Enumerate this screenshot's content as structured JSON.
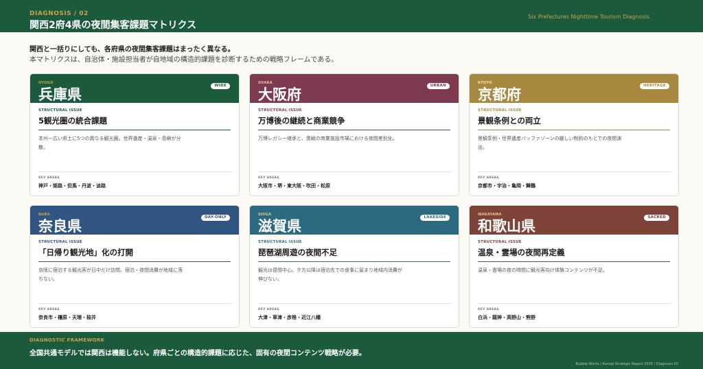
{
  "header": {
    "kicker": "DIAGNOSIS / 02",
    "title": "関西2府4県の夜間集客課題マトリクス",
    "right_label": "Six Prefectures Nighttime Tourism Diagnosis"
  },
  "intro": {
    "line1": "関西と一括りにしても、各府県の夜間集客課題はまったく異なる。",
    "line2": "本マトリクスは、自治体・施設担当者が自地域の構造的課題を診断するための戦略フレームである。"
  },
  "card_labels": {
    "structural_issue": "STRUCTURAL ISSUE",
    "key_areas": "KEY AREAS"
  },
  "colors": {
    "hyogo": "#1c5a3d",
    "osaka": "#7d3a4e",
    "kyoto": "#a8883e",
    "nara": "#2f5580",
    "shiga": "#2c6b7f",
    "wakayama": "#7d4238"
  },
  "cards": [
    {
      "eng": "HYOGO",
      "name": "兵庫県",
      "tag": "WIDE",
      "issue": "5観光圏の統合課題",
      "desc": "本州一広い県土に5つの異なる観光圏。世界遺産・温泉・島嶼が分散。",
      "areas": "神戸・姫路・但馬・丹波・淡路"
    },
    {
      "eng": "OSAKA",
      "name": "大阪府",
      "tag": "URBAN",
      "issue": "万博後の継続と商業競争",
      "desc": "万博レガシー継承と、激戦の商業施設市場における夜間差別化。",
      "areas": "大阪市・堺・東大阪・吹田・松原"
    },
    {
      "eng": "KYOTO",
      "name": "京都府",
      "tag": "HERITAGE",
      "issue": "景観条例との両立",
      "desc": "景観条例・世界遺産バッファゾーンの厳しい制約のもとでの夜間演出。",
      "areas": "京都市・宇治・亀岡・舞鶴"
    },
    {
      "eng": "NARA",
      "name": "奈良県",
      "tag": "DAY-ONLY",
      "issue": "「日帰り観光地」化の打開",
      "desc": "京阪に宿泊する観光客が日中だけ訪問。宿泊・夜間消費が地域に落ちない。",
      "areas": "奈良市・橿原・天理・桜井"
    },
    {
      "eng": "SHIGA",
      "name": "滋賀県",
      "tag": "LAKESIDE",
      "issue": "琵琶湖周遊の夜間不足",
      "desc": "観光は昼間中心。夕方以降は宿泊先での食事に留まり地域内消費が伸びない。",
      "areas": "大津・草津・彦根・近江八幡"
    },
    {
      "eng": "WAKAYAMA",
      "name": "和歌山県",
      "tag": "SACRED",
      "issue": "温泉・霊場の夜間再定義",
      "desc": "温泉・霊場の夜の時間に観光客向け体験コンテンツが不足。",
      "areas": "白浜・龍神・高野山・熊野"
    }
  ],
  "footer": {
    "kicker": "DIAGNOSTIC FRAMEWORK",
    "text": "全国共通モデルでは関西は機能しない。府県ごとの構造的課題に応じた、固有の夜間コンテンツ戦略が必要。",
    "credit": "Bubble Works / Kansai Strategic Report 2026 / Diagnosis 02"
  }
}
